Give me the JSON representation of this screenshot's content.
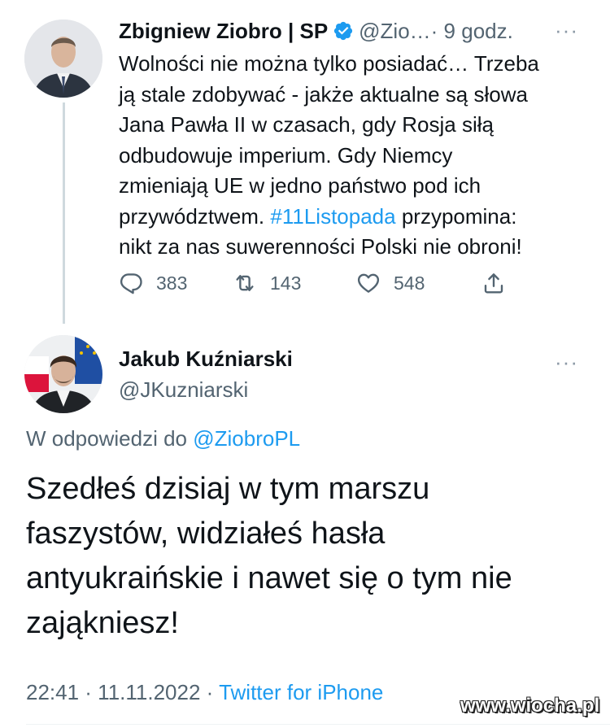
{
  "tweet1": {
    "author_name": "Zbigniew Ziobro | SP",
    "handle": "@Zio…",
    "time": " · 9 godz.",
    "more": "···",
    "body_lines": [
      "Wolności nie można tylko posiadać… Trzeba",
      "ją stale zdobywać - jakże aktualne są słowa",
      "Jana Pawła II w czasach, gdy Rosja siłą",
      "odbudowuje imperium. Gdy Niemcy",
      "zmieniają UE w jedno państwo pod ich",
      "przywództwem. ",
      "#11Listopada",
      " przypomina:",
      "nikt za nas suwerenności Polski nie obroni!"
    ],
    "replies": "383",
    "retweets": "143",
    "likes": "548"
  },
  "tweet2": {
    "author_name": "Jakub Kuźniarski",
    "handle": "@JKuzniarski",
    "more": "···",
    "reply_prefix": "W odpowiedzi do ",
    "reply_mention": "@ZiobroPL",
    "body_lines": [
      "Szedłeś dzisiaj w tym marszu",
      "faszystów, widziałeś hasła",
      "antyukraińskie i nawet się o tym nie",
      "zająkniesz!"
    ],
    "timestamp": "22:41 · 11.11.2022 · ",
    "client": "Twitter for iPhone"
  },
  "watermark": "www.wiocha.pl",
  "colors": {
    "accent": "#1d9bf0",
    "secondary_text": "#536471",
    "primary_text": "#0f1419"
  },
  "icons": {
    "verified": "verified-badge-icon",
    "reply": "reply-icon",
    "retweet": "retweet-icon",
    "like": "heart-icon",
    "share": "share-icon"
  }
}
